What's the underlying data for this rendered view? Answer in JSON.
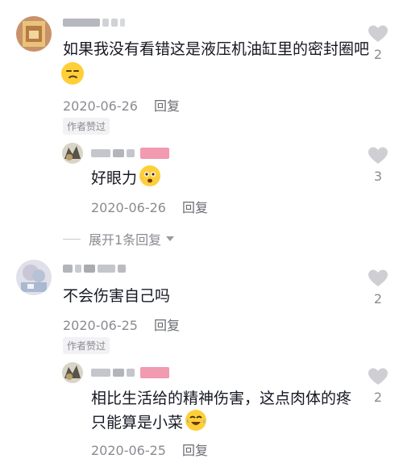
{
  "colors": {
    "heart": "#cfcfd3",
    "meta": "#8a8b91",
    "text": "#161823"
  },
  "comments": [
    {
      "text_line1": "如果我没有看错这是液压机油缸里的密封圈吧",
      "emoji": "unamused-face",
      "date": "2020-06-26",
      "reply_label": "回复",
      "badge": "作者赞过",
      "likes": "2",
      "reply": {
        "text": "好眼力",
        "emoji": "amazed-face",
        "date": "2020-06-26",
        "reply_label": "回复",
        "likes": "3"
      },
      "expand_label": "展开1条回复"
    },
    {
      "text_line1": "不会伤害自己吗",
      "date": "2020-06-25",
      "reply_label": "回复",
      "badge": "作者赞过",
      "likes": "2",
      "reply": {
        "text_line1": "相比生活给的精神伤害，这点肉体的疼",
        "text_line2": "只能算是小菜",
        "emoji": "laughing-crying-face",
        "date": "2020-06-25",
        "reply_label": "回复",
        "likes": "2"
      }
    }
  ]
}
